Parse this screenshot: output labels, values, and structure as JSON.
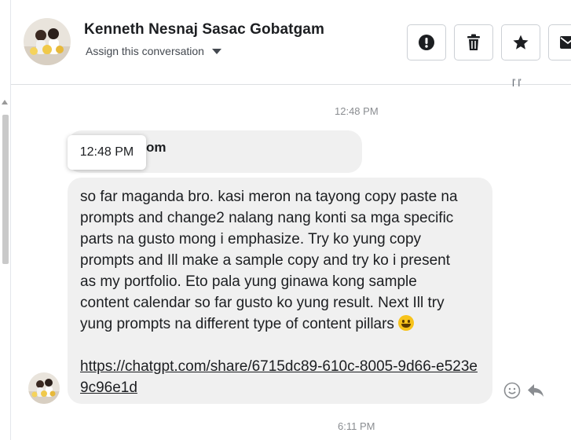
{
  "header": {
    "contact_name": "Kenneth Nesnaj Sasac Gobatgam",
    "assign_label": "Assign this conversation",
    "buttons": [
      {
        "name": "spam",
        "icon": "exclamation-circle-icon"
      },
      {
        "name": "delete",
        "icon": "trash-icon"
      },
      {
        "name": "star",
        "icon": "star-icon"
      },
      {
        "name": "mail",
        "icon": "envelope-icon"
      }
    ]
  },
  "thread": {
    "clipped_top_text": "ľ ľ",
    "timestamp_1": "12:48 PM",
    "tooltip_time": "12:48 PM",
    "prev_message_fragment": "om",
    "message_text": "so far maganda bro. kasi meron na tayong copy paste na\nprompts and change2 nalang nang konti sa mga specific\nparts na gusto mong i emphasize. Try ko yung copy\nprompts and Ill make a sample copy and try ko i present\nas my portfolio. Eto pala yung ginawa kong sample\ncontent calendar so far gusto ko yung result. Next Ill try\nyung prompts na different type of content pillars ",
    "message_emoji": "grinning-face",
    "message_link": "https://chatgpt.com/share/6715dc89-610c-8005-9d66-e523e9c96e1d",
    "timestamp_2": "6:11 PM"
  },
  "colors": {
    "bubble": "#f0f0f0",
    "timestamp": "#8a8d91",
    "border": "#ccd0d5"
  }
}
